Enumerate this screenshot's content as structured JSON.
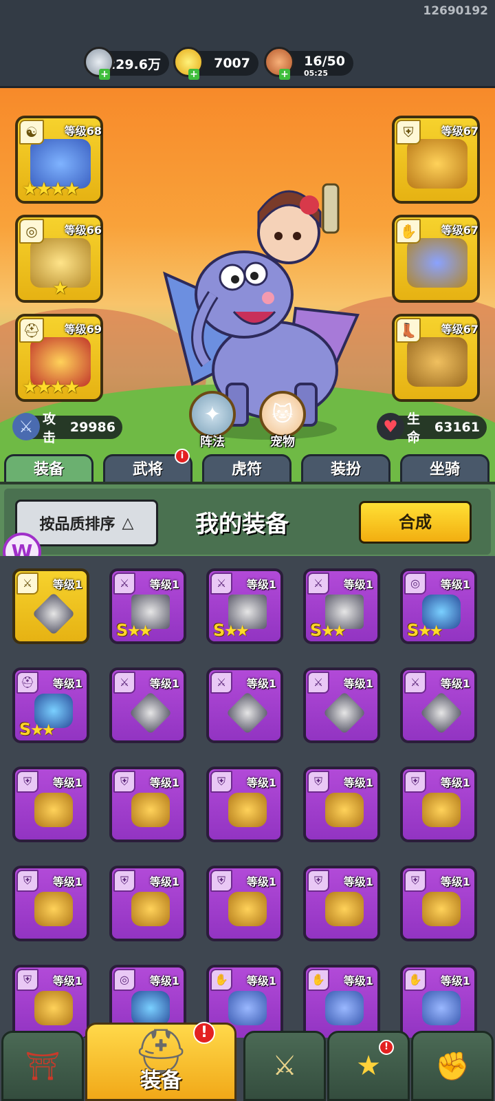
{
  "uid": "12690192",
  "resources": [
    {
      "icon": "silver-coin-icon",
      "value": "229.6万",
      "sub": ""
    },
    {
      "icon": "gold-ingot-icon",
      "value": "7007",
      "sub": ""
    },
    {
      "icon": "meat-stamina-icon",
      "value": "16/50",
      "sub": "05:25"
    }
  ],
  "equipped": {
    "left": [
      {
        "type_icon": "☯",
        "level": "等级68",
        "stars": "★★★★"
      },
      {
        "type_icon": "◎",
        "level": "等级66",
        "stars": "★"
      },
      {
        "type_icon": "⛑",
        "level": "等级69",
        "stars": "★★★★"
      }
    ],
    "right": [
      {
        "type_icon": "⛨",
        "level": "等级67"
      },
      {
        "type_icon": "✋",
        "level": "等级67"
      },
      {
        "type_icon": "👢",
        "level": "等级67"
      }
    ]
  },
  "stats": {
    "attack_label": "攻击",
    "attack_value": "29986",
    "hp_label": "生命",
    "hp_value": "63161"
  },
  "round_buttons": {
    "formation": "阵法",
    "pet": "宠物"
  },
  "tabs": [
    "装备",
    "武将",
    "虎符",
    "装扮",
    "坐骑"
  ],
  "tab_badge": "i",
  "panel": {
    "sort_label": "按品质排序",
    "sort_arrow": "△",
    "title": "我的装备",
    "merge_label": "合成"
  },
  "inventory": [
    {
      "level": "等级1",
      "type": "weapon",
      "quality": "gold",
      "grade": "",
      "stars": ""
    },
    {
      "level": "等级1",
      "type": "weapon",
      "quality": "purple",
      "grade": "S",
      "stars": "★★"
    },
    {
      "level": "等级1",
      "type": "weapon",
      "quality": "purple",
      "grade": "S",
      "stars": "★★"
    },
    {
      "level": "等级1",
      "type": "weapon",
      "quality": "purple",
      "grade": "S",
      "stars": "★★"
    },
    {
      "level": "等级1",
      "type": "amulet",
      "quality": "purple",
      "grade": "S",
      "stars": "★★"
    },
    {
      "level": "等级1",
      "type": "helmet",
      "quality": "purple",
      "grade": "S",
      "stars": "★★"
    },
    {
      "level": "等级1",
      "type": "weapon",
      "quality": "purple",
      "grade": "",
      "stars": ""
    },
    {
      "level": "等级1",
      "type": "weapon",
      "quality": "purple",
      "grade": "",
      "stars": ""
    },
    {
      "level": "等级1",
      "type": "weapon",
      "quality": "purple",
      "grade": "",
      "stars": ""
    },
    {
      "level": "等级1",
      "type": "weapon",
      "quality": "purple",
      "grade": "",
      "stars": ""
    },
    {
      "level": "等级1",
      "type": "armor",
      "quality": "purple",
      "grade": "",
      "stars": ""
    },
    {
      "level": "等级1",
      "type": "armor",
      "quality": "purple",
      "grade": "",
      "stars": ""
    },
    {
      "level": "等级1",
      "type": "armor",
      "quality": "purple",
      "grade": "",
      "stars": ""
    },
    {
      "level": "等级1",
      "type": "armor",
      "quality": "purple",
      "grade": "",
      "stars": ""
    },
    {
      "level": "等级1",
      "type": "armor",
      "quality": "purple",
      "grade": "",
      "stars": ""
    },
    {
      "level": "等级1",
      "type": "armor",
      "quality": "purple",
      "grade": "",
      "stars": ""
    },
    {
      "level": "等级1",
      "type": "armor",
      "quality": "purple",
      "grade": "",
      "stars": ""
    },
    {
      "level": "等级1",
      "type": "armor",
      "quality": "purple",
      "grade": "",
      "stars": ""
    },
    {
      "level": "等级1",
      "type": "armor",
      "quality": "purple",
      "grade": "",
      "stars": ""
    },
    {
      "level": "等级1",
      "type": "armor",
      "quality": "purple",
      "grade": "",
      "stars": ""
    },
    {
      "level": "等级1",
      "type": "armor",
      "quality": "purple",
      "grade": "",
      "stars": ""
    },
    {
      "level": "等级1",
      "type": "amulet",
      "quality": "purple",
      "grade": "",
      "stars": ""
    },
    {
      "level": "等级1",
      "type": "gauntlet",
      "quality": "purple",
      "grade": "",
      "stars": ""
    },
    {
      "level": "等级1",
      "type": "gauntlet",
      "quality": "purple",
      "grade": "",
      "stars": ""
    },
    {
      "level": "等级1",
      "type": "gauntlet",
      "quality": "purple",
      "grade": "",
      "stars": ""
    }
  ],
  "nav": [
    {
      "icon": "castle-gate-icon",
      "label": ""
    },
    {
      "icon": "helmet-icon",
      "label": "装备",
      "badge": "!"
    },
    {
      "icon": "crossed-swords-shield-icon",
      "label": ""
    },
    {
      "icon": "rooster-star-icon",
      "label": "",
      "badge": "!"
    },
    {
      "icon": "fist-upgrade-icon",
      "label": ""
    }
  ],
  "watermark": "W"
}
